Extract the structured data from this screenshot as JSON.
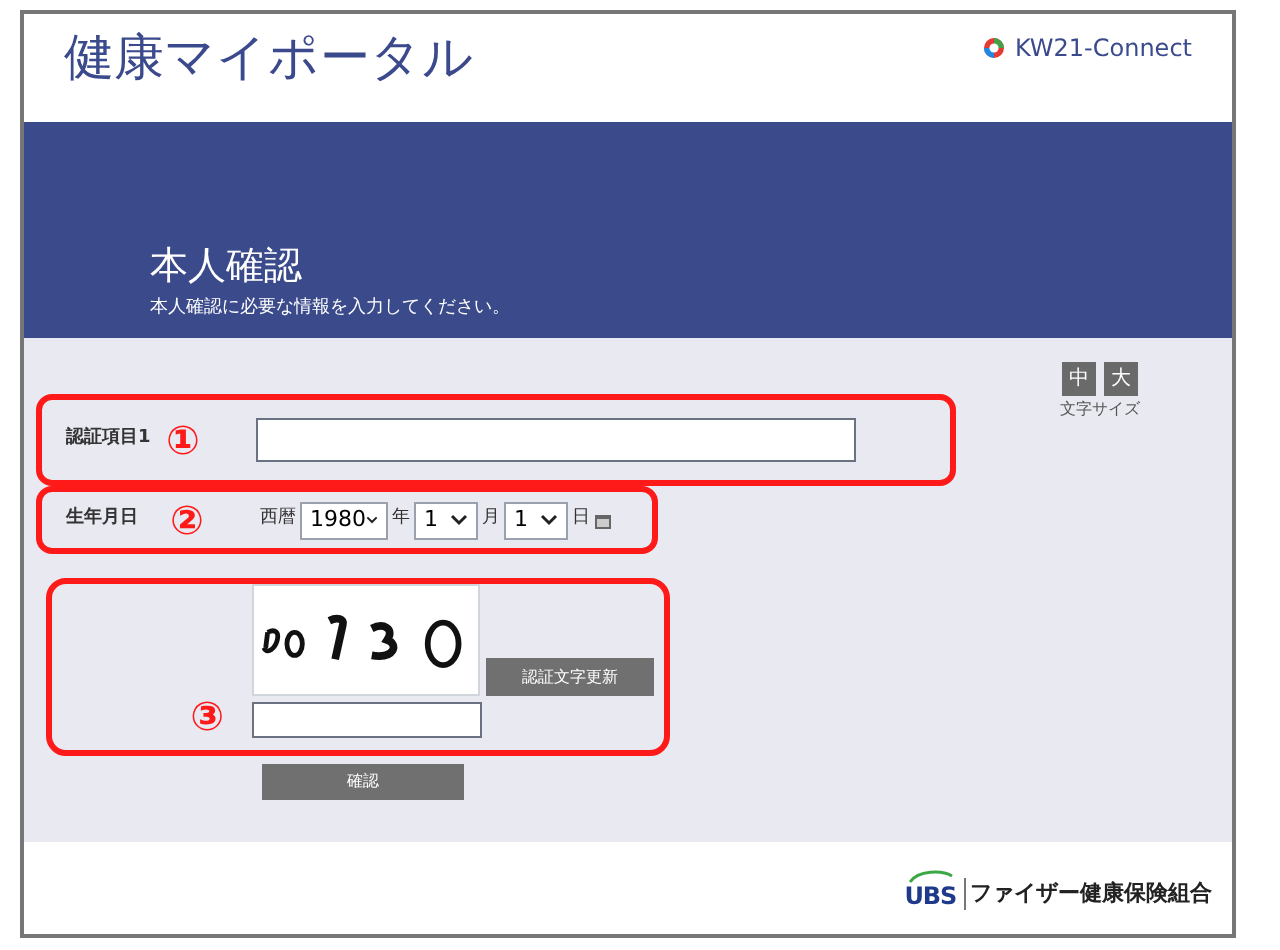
{
  "header": {
    "title": "健康マイポータル",
    "brand": "KW21-Connect"
  },
  "banner": {
    "title": "本人確認",
    "subtitle": "本人確認に必要な情報を入力してください。"
  },
  "font_size": {
    "buttons": [
      {
        "label": "中"
      },
      {
        "label": "大"
      }
    ],
    "caption": "文字サイズ"
  },
  "auth_item": {
    "label": "認証項目1",
    "marker": "①"
  },
  "birthdate": {
    "label": "生年月日",
    "marker": "②",
    "era": "西暦",
    "year": "1980",
    "year_unit": "年",
    "month": "1",
    "month_unit": "月",
    "day": "1",
    "day_unit": "日"
  },
  "captcha": {
    "kind": "picture",
    "marker": "③",
    "refresh_button": "認証文字更新"
  },
  "submit_button": "確認",
  "footer": {
    "logo": "UBS",
    "org": "ファイザー健康保険組合"
  }
}
